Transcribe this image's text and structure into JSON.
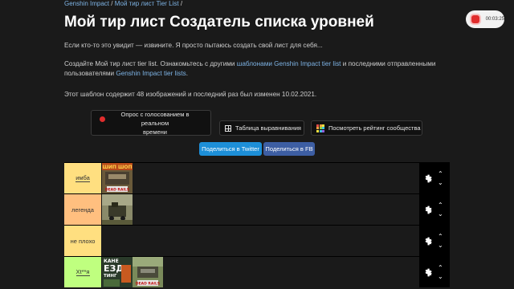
{
  "breadcrumb": {
    "items": [
      "Genshin Impact",
      "Мой тир лист Tier List"
    ],
    "sep": "/"
  },
  "title": "Мой тир лист Создатель списка уровней",
  "intro": "Если кто-то это увидит — извините. Я просто пытаюсь создать свой лист для себя...",
  "desc": {
    "part1": "Создайте Мой тир лист tier list. Ознакомьтесь с другими ",
    "link1": "шаблонами Genshin Impact tier list",
    "part2": " и последними отправленными",
    "part3": "пользователями ",
    "link2": "Genshin Impact tier lists",
    "part4": "."
  },
  "meta": "Этот шаблон содержит 48 изображений и последний раз был изменен 10.02.2021.",
  "recorder": {
    "time": "00:03:25"
  },
  "buttons": {
    "vote_line1": "Опрос с голосованием в реальном",
    "vote_line2": "времени",
    "align": "Таблица выравнивания",
    "rating": "Посмотреть рейтинг сообщества",
    "twitter": "Поделиться в Twitter",
    "facebook": "Поделиться в FB"
  },
  "tiers": [
    {
      "label": "имба",
      "color": "#ffdf80",
      "underline": true
    },
    {
      "label": "легенда",
      "color": "#ffbf7f",
      "underline": false
    },
    {
      "label": "не плохо",
      "color": "#ffdf80",
      "underline": false
    },
    {
      "label": "Xt**я",
      "color": "#bfff7f",
      "underline": true
    }
  ],
  "thumb_texts": {
    "shipshop": "ШИП ШОП",
    "deadrails": "DEAD RAILS",
    "kanal": "КАНЕ",
    "ezd": "ЕЗД",
    "ting": "ТИНГ"
  },
  "colors": {
    "accent_link": "#7eb4e6",
    "twitter": "#1d8fd8",
    "facebook": "#3d5ea3",
    "record": "#e02d2d"
  },
  "icons": [
    "gear-icon",
    "chevron-up-icon",
    "chevron-down-icon",
    "record-icon",
    "grid-icon",
    "rating-grid-icon"
  ]
}
